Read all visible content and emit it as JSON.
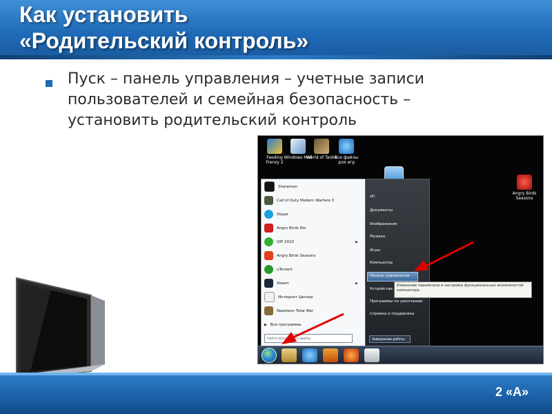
{
  "slide": {
    "title_line1": "Как установить",
    "title_line2": "«Родительский контроль»",
    "body_line1": "Пуск – панель управления – учетные записи",
    "body_line2": "пользователей и семейная безопасность –",
    "body_line3": "установить родительский контроль",
    "page_number": "2 «А»"
  },
  "colors": {
    "header": "#1f6bb8",
    "footer": "#1b5fa6",
    "arrow": "#e00000",
    "bullet": "#1f6bb8"
  },
  "desktop": {
    "icons": [
      {
        "label": "Feeding Frenzy 2",
        "icon": "game-icon"
      },
      {
        "label": "Windows Mail",
        "icon": "mail-icon"
      },
      {
        "label": "World of Tanks",
        "icon": "tank-game-icon"
      },
      {
        "label": "Все файлы для игр",
        "icon": "ie-icon"
      }
    ],
    "right_icon": {
      "label": "Angry Birds Seasons",
      "icon": "angry-birds-icon"
    }
  },
  "start_menu": {
    "programs": [
      {
        "label": "Shareman",
        "arrow": false
      },
      {
        "label": "Call of Duty Modern Warfare 3",
        "arrow": false
      },
      {
        "label": "Skype",
        "arrow": false
      },
      {
        "label": "Angry Birds Rio",
        "arrow": false
      },
      {
        "label": "QIP 2010",
        "arrow": true
      },
      {
        "label": "Angry Birds Seasons",
        "arrow": false
      },
      {
        "label": "uTorrent",
        "arrow": false
      },
      {
        "label": "Steam",
        "arrow": true
      },
      {
        "label": "Интернет Цензор",
        "arrow": false
      },
      {
        "label": "Napoleon Total War",
        "arrow": false
      }
    ],
    "all_programs": "Все программы",
    "search_placeholder": "Найти программы и файлы",
    "right_items": [
      {
        "label": "sD"
      },
      {
        "label": "Документы"
      },
      {
        "label": "Изображения"
      },
      {
        "label": "Музыка"
      },
      {
        "label": "Игры"
      },
      {
        "label": "Компьютер"
      },
      {
        "label": "Панель управления"
      },
      {
        "label": "Устройства и принтеры"
      },
      {
        "label": "Программы по умолчанию"
      },
      {
        "label": "Справка и поддержка"
      }
    ],
    "tooltip": "Изменение параметров и настройка функциональных возможностей компьютера.",
    "shutdown": "Завершение работы"
  }
}
